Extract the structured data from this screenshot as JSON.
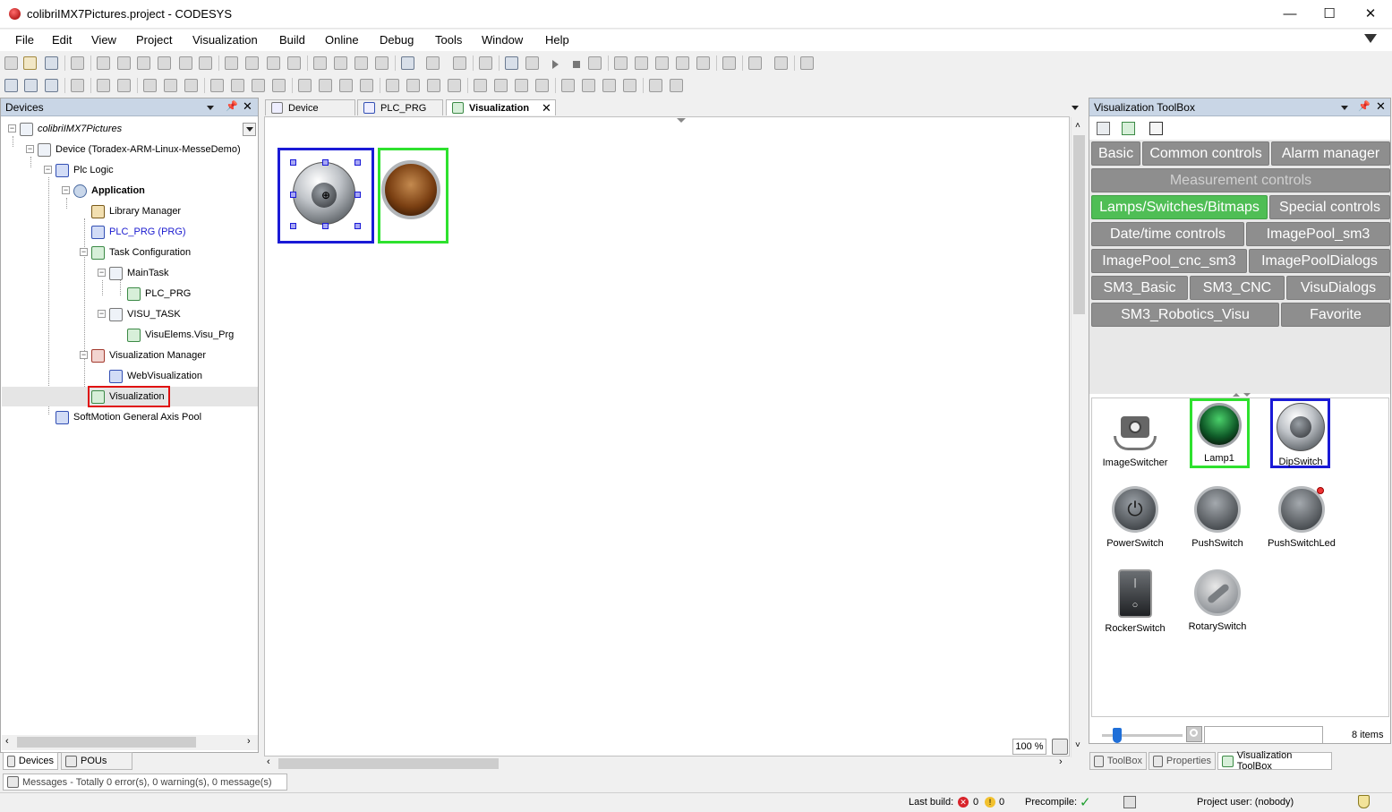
{
  "window": {
    "title": "colibriIMX7Pictures.project - CODESYS",
    "minimize": "—",
    "maximize": "☐",
    "close": "✕"
  },
  "menu": [
    "File",
    "Edit",
    "View",
    "Project",
    "Visualization",
    "Build",
    "Online",
    "Debug",
    "Tools",
    "Window",
    "Help"
  ],
  "devices_panel": {
    "title": "Devices",
    "tree": [
      {
        "label": "colibriIMX7Pictures",
        "icon": "project-icon"
      },
      {
        "label": "Device (Toradex-ARM-Linux-MesseDemo)",
        "icon": "device-icon"
      },
      {
        "label": "Plc Logic",
        "icon": "plc-logic-icon"
      },
      {
        "label": "Application",
        "icon": "application-gear-icon"
      },
      {
        "label": "Library Manager",
        "icon": "library-icon"
      },
      {
        "label": "PLC_PRG (PRG)",
        "icon": "program-icon"
      },
      {
        "label": "Task Configuration",
        "icon": "task-config-icon"
      },
      {
        "label": "MainTask",
        "icon": "task-icon"
      },
      {
        "label": "PLC_PRG",
        "icon": "program-call-icon"
      },
      {
        "label": "VISU_TASK",
        "icon": "task-icon"
      },
      {
        "label": "VisuElems.Visu_Prg",
        "icon": "program-call-icon"
      },
      {
        "label": "Visualization Manager",
        "icon": "visu-manager-icon"
      },
      {
        "label": "WebVisualization",
        "icon": "web-visu-icon"
      },
      {
        "label": "Visualization",
        "icon": "visualization-icon"
      },
      {
        "label": "SoftMotion General Axis Pool",
        "icon": "axis-pool-icon"
      }
    ],
    "bottom_tabs": [
      "Devices",
      "POUs"
    ]
  },
  "editor": {
    "tabs": [
      "Device",
      "PLC_PRG",
      "Visualization"
    ],
    "active_tab": "Visualization",
    "zoom": "100 %"
  },
  "toolbox_panel": {
    "title": "Visualization ToolBox",
    "categories": [
      "Basic",
      "Common controls",
      "Alarm manager",
      "Measurement controls",
      "Lamps/Switches/Bitmaps",
      "Special controls",
      "Date/time controls",
      "ImagePool_sm3",
      "ImagePool_cnc_sm3",
      "ImagePoolDialogs",
      "SM3_Basic",
      "SM3_CNC",
      "VisuDialogs",
      "SM3_Robotics_Visu",
      "Favorite"
    ],
    "active_category": "Lamps/Switches/Bitmaps",
    "items": [
      "ImageSwitcher",
      "Lamp1",
      "DipSwitch",
      "PowerSwitch",
      "PushSwitch",
      "PushSwitchLed",
      "RockerSwitch",
      "RotarySwitch"
    ],
    "item_count": "8 items",
    "search_value": "",
    "bottom_tabs": [
      "ToolBox",
      "Properties",
      "Visualization ToolBox"
    ]
  },
  "messages_bar": "Messages - Totally 0 error(s), 0 warning(s), 0 message(s)",
  "status": {
    "last_build_label": "Last build:",
    "errors": "0",
    "warnings": "0",
    "precompile_label": "Precompile:",
    "project_user": "Project user: (nobody)"
  },
  "colors": {
    "selected_blue": "#1a1ad6",
    "selected_green": "#2ee12e",
    "selected_red": "#e01010",
    "active_category": "#4fbe55",
    "category_button": "#8e8e8e"
  }
}
